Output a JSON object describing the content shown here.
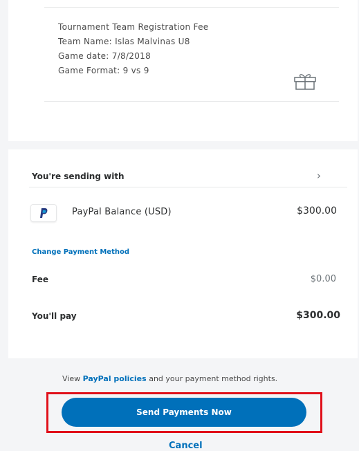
{
  "item": {
    "lines": [
      "Tournament Team Registration Fee",
      "Team Name: Islas Malvinas U8",
      "Game date: 7/8/2018",
      "Game Format: 9 vs 9"
    ]
  },
  "funding": {
    "heading": "You're sending with",
    "source_label": "PayPal Balance (USD)",
    "source_amount": "$300.00",
    "change_link": "Change Payment Method",
    "fee_label": "Fee",
    "fee_amount": "$0.00",
    "total_label": "You'll pay",
    "total_amount": "$300.00"
  },
  "footer": {
    "policy_prefix": "View",
    "policy_link": "PayPal policies",
    "policy_suffix": "and your payment method rights.",
    "send_button": "Send Payments Now",
    "cancel_link": "Cancel"
  },
  "colors": {
    "brand_blue": "#0070ba",
    "highlight_red": "#e0101a"
  }
}
